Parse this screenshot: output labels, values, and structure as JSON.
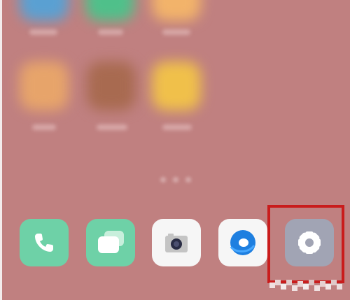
{
  "screen": {
    "wallpaper_color": "#c08080"
  },
  "blurred_home_icons": [
    {
      "name": "app-1",
      "color": "#5aa0d2"
    },
    {
      "name": "app-2",
      "color": "#4fc08a"
    },
    {
      "name": "app-3",
      "color": "#f2b36a"
    },
    {
      "name": "app-4",
      "color": "#e7a46a"
    },
    {
      "name": "app-5",
      "color": "#b06a52"
    },
    {
      "name": "app-6",
      "color": "#f0c04a"
    }
  ],
  "dock": {
    "apps": [
      {
        "name": "phone",
        "icon": "phone-icon",
        "color": "#6ed1a7"
      },
      {
        "name": "messages",
        "icon": "chat-bubbles-icon",
        "color": "#6ed1a7"
      },
      {
        "name": "camera",
        "icon": "camera-icon",
        "color": "#f6f6f6"
      },
      {
        "name": "browser",
        "icon": "browser-ring-icon",
        "color": "#f6f6f6"
      },
      {
        "name": "settings",
        "icon": "gear-icon",
        "color": "#a1a4b4"
      }
    ]
  },
  "annotation": {
    "highlight_color": "#c91c1c",
    "target": "settings"
  },
  "watermark": {
    "text": ""
  }
}
